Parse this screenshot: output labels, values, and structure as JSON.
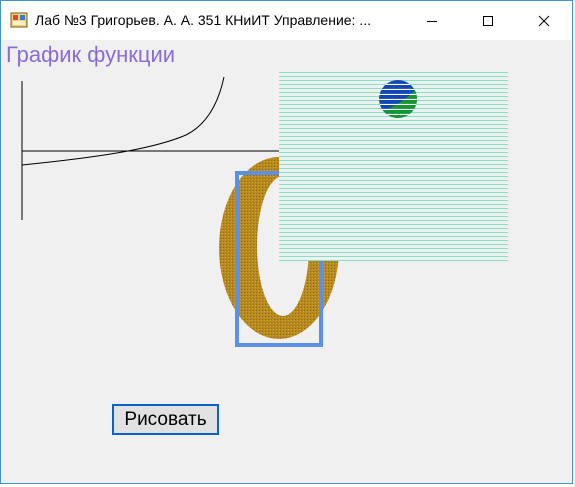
{
  "window": {
    "title": "Лаб №3 Григорьев. А. А. 351 КНиИТ Управление: ..."
  },
  "titlebar_buttons": {
    "minimize_icon": "minimize-icon",
    "maximize_icon": "maximize-icon",
    "close_icon": "close-icon"
  },
  "client": {
    "heading": "График функции",
    "draw_button_label": "Рисовать"
  },
  "colors": {
    "heading": "#8a6bd8",
    "button_border": "#0a64c8",
    "torus_fill": "#b8891e",
    "rect_outline": "#5b8fe8",
    "hatch_lines": "#7fe3c8",
    "globe_blue": "#1446b4",
    "globe_green": "#149632"
  }
}
